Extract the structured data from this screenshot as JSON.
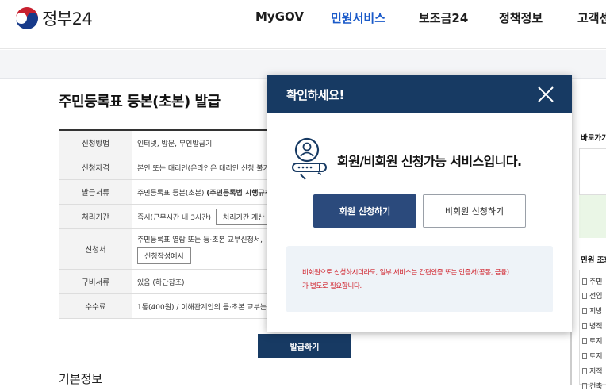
{
  "header": {
    "logo_text": "정부24",
    "nav": [
      "MyGOV",
      "민원서비스",
      "보조금24",
      "정책정보",
      "고객센"
    ]
  },
  "main": {
    "title": "주민등록표 등본(초본) 발급",
    "rows": [
      {
        "label": "신청방법",
        "value": "인터넷, 방문, 무인발급기"
      },
      {
        "label": "신청자격",
        "value": "본인 또는 대리인(온라인은 대리인 신청 불가)"
      },
      {
        "label": "발급서류",
        "value": "주민등록표 등본(초본) ",
        "value_bold": "(주민등록법 시행규칙"
      },
      {
        "label": "처리기간",
        "value": "즉시(근무시간 내 3시간)",
        "button": "처리기간 계산 방"
      },
      {
        "label": "신청서",
        "value": "주민등록표 열람 또는 등·초본 교부신청서,",
        "button": "신청작성예시"
      },
      {
        "label": "구비서류",
        "value": "있음 (하단참조)"
      },
      {
        "label": "수수료",
        "value": "1통(400원) / 이해관계인의 등·초본 교부는"
      }
    ],
    "issue_button": "발급하기",
    "section_title": "기본정보"
  },
  "right_col": {
    "title1": "바로가기",
    "title2": "민원 조회",
    "items": [
      "주민",
      "전입",
      "지방",
      "병적",
      "토지",
      "토지",
      "지적",
      "건축"
    ]
  },
  "modal": {
    "title": "확인하세요!",
    "message": "회원/비회원 신청가능 서비스입니다.",
    "member_button": "회원 신청하기",
    "guest_button": "비회원 신청하기",
    "notice_line1": "비회원으로 신청하시더라도, 일부 서비스는 간편인증 또는 인증서(공동, 금융)",
    "notice_line2": "가 별도로 필요합니다."
  },
  "colors": {
    "navy": "#173a63",
    "accent_blue": "#1a5ac9",
    "notice_red": "#d0202a"
  }
}
